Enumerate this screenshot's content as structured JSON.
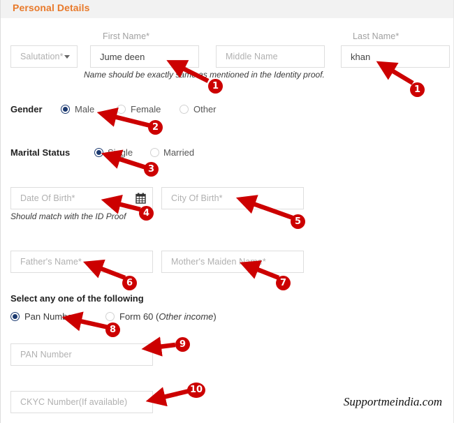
{
  "header": {
    "title": "Personal Details",
    "accent_color": "#e8792a",
    "band_color": "#f2f2f2"
  },
  "colors": {
    "annotation_red": "#cc0000",
    "radio_selected": "#1c3a70",
    "placeholder_gray": "#b0b0b0",
    "field_border": "#dedede"
  },
  "name_row": {
    "labels": {
      "first_name": "First Name*",
      "last_name": "Last Name*"
    },
    "salutation": {
      "placeholder": "Salutation*",
      "value": "",
      "icon": "chevron-down-icon"
    },
    "first_name": {
      "placeholder": "First Name*",
      "value": "Jume deen"
    },
    "middle_name": {
      "placeholder": "Middle Name",
      "value": ""
    },
    "last_name": {
      "placeholder": "Last Name*",
      "value": "khan"
    },
    "hint": "Name should be exactly same as mentioned in the Identity proof."
  },
  "gender": {
    "label": "Gender",
    "options": [
      {
        "label": "Male",
        "selected": true
      },
      {
        "label": "Female",
        "selected": false
      },
      {
        "label": "Other",
        "selected": false
      }
    ]
  },
  "marital_status": {
    "label": "Marital Status",
    "options": [
      {
        "label": "Single",
        "selected": true
      },
      {
        "label": "Married",
        "selected": false
      }
    ]
  },
  "birth_row": {
    "date_of_birth": {
      "placeholder": "Date Of Birth*",
      "value": "",
      "icon": "calendar-icon"
    },
    "city_of_birth": {
      "placeholder": "City Of Birth*",
      "value": ""
    },
    "hint": "Should match with the ID Proof"
  },
  "parents_row": {
    "fathers_name": {
      "placeholder": "Father's Name*",
      "value": ""
    },
    "mothers_maiden_name": {
      "placeholder": "Mother's Maiden Name*",
      "value": ""
    }
  },
  "id_choice": {
    "label": "Select any one of the following",
    "options": [
      {
        "label": "Pan Number",
        "selected": true,
        "italic_part": ""
      },
      {
        "label": "Form 60 (",
        "selected": false,
        "italic_part": "Other income",
        "suffix": ")"
      }
    ]
  },
  "pan": {
    "placeholder": "PAN Number",
    "value": ""
  },
  "ckyc": {
    "placeholder": "CKYC Number(If available)",
    "value": ""
  },
  "annotations": {
    "badges": [
      {
        "n": "1",
        "target": "first-name-input"
      },
      {
        "n": "1",
        "target": "last-name-input"
      },
      {
        "n": "2",
        "target": "gender-male-radio"
      },
      {
        "n": "3",
        "target": "marital-single-radio"
      },
      {
        "n": "4",
        "target": "date-of-birth-input"
      },
      {
        "n": "5",
        "target": "city-of-birth-input"
      },
      {
        "n": "6",
        "target": "fathers-name-input"
      },
      {
        "n": "7",
        "target": "mothers-maiden-name-input"
      },
      {
        "n": "8",
        "target": "pan-number-radio"
      },
      {
        "n": "9",
        "target": "pan-number-input"
      },
      {
        "n": "10",
        "target": "ckyc-number-input"
      }
    ]
  },
  "watermark": "Supportmeindia.com"
}
